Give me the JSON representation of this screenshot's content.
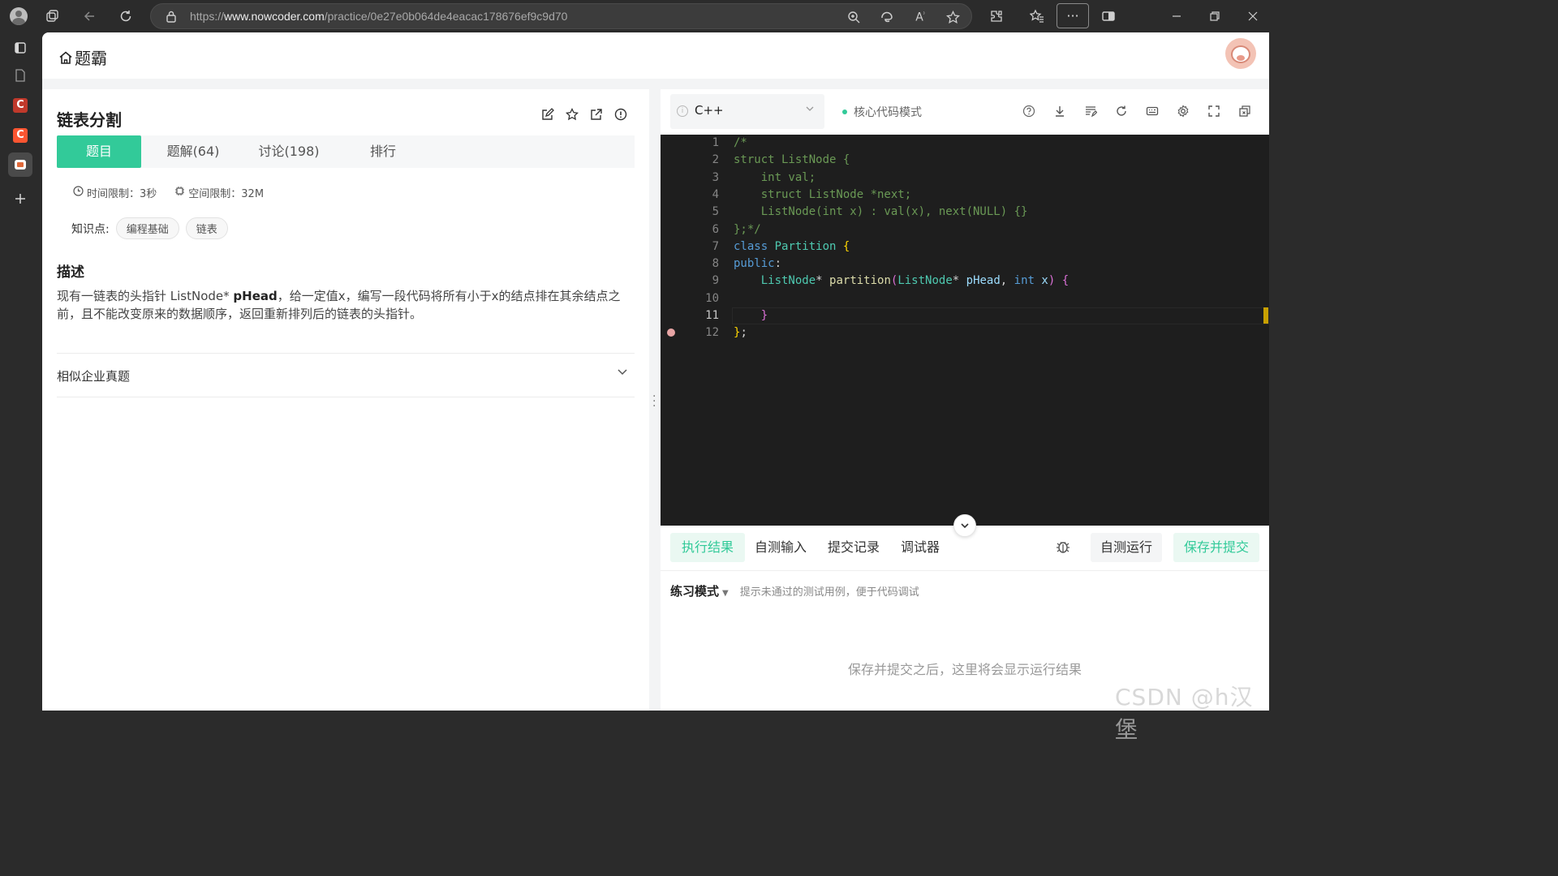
{
  "browser": {
    "url_prefix": "https://",
    "url_domain": "www.nowcoder.com",
    "url_path": "/practice/0e27e0b064de4eacac178676ef9c9d70",
    "more_label": "···"
  },
  "site": {
    "logo_text": "题霸"
  },
  "problem": {
    "title": "链表分割",
    "tabs": [
      {
        "label": "题目"
      },
      {
        "label": "题解(64)"
      },
      {
        "label": "讨论(198)"
      },
      {
        "label": "排行"
      }
    ],
    "time_limit": "时间限制：3秒",
    "space_limit": "空间限制：32M",
    "knowledge_label": "知识点:",
    "knowledge_tags": [
      "编程基础",
      "链表"
    ],
    "desc_heading": "描述",
    "desc_part1": "现有一链表的头指针 ListNode* ",
    "desc_bold": "pHead",
    "desc_part2": "，给一定值x，编写一段代码将所有小于x的结点排在其余结点之前，且不能改变原来的数据顺序，返回重新排列后的链表的头指针。",
    "similar_label": "相似企业真题"
  },
  "editor": {
    "language": "C++",
    "mode_label": "核心代码模式",
    "line_numbers": [
      "1",
      "2",
      "3",
      "4",
      "5",
      "6",
      "7",
      "8",
      "9",
      "10",
      "11",
      "12"
    ]
  },
  "console": {
    "tabs": [
      {
        "label": "执行结果"
      },
      {
        "label": "自测输入"
      },
      {
        "label": "提交记录"
      },
      {
        "label": "调试器"
      }
    ],
    "run_label": "自测运行",
    "submit_label": "保存并提交",
    "practice_mode": "练习模式",
    "practice_hint": "提示未通过的测试用例，便于代码调试",
    "empty_message": "保存并提交之后，这里将会显示运行结果"
  },
  "watermark": "CSDN @h汉堡",
  "colors": {
    "accent": "#32ca99",
    "editor_bg": "#1e1e1e"
  }
}
